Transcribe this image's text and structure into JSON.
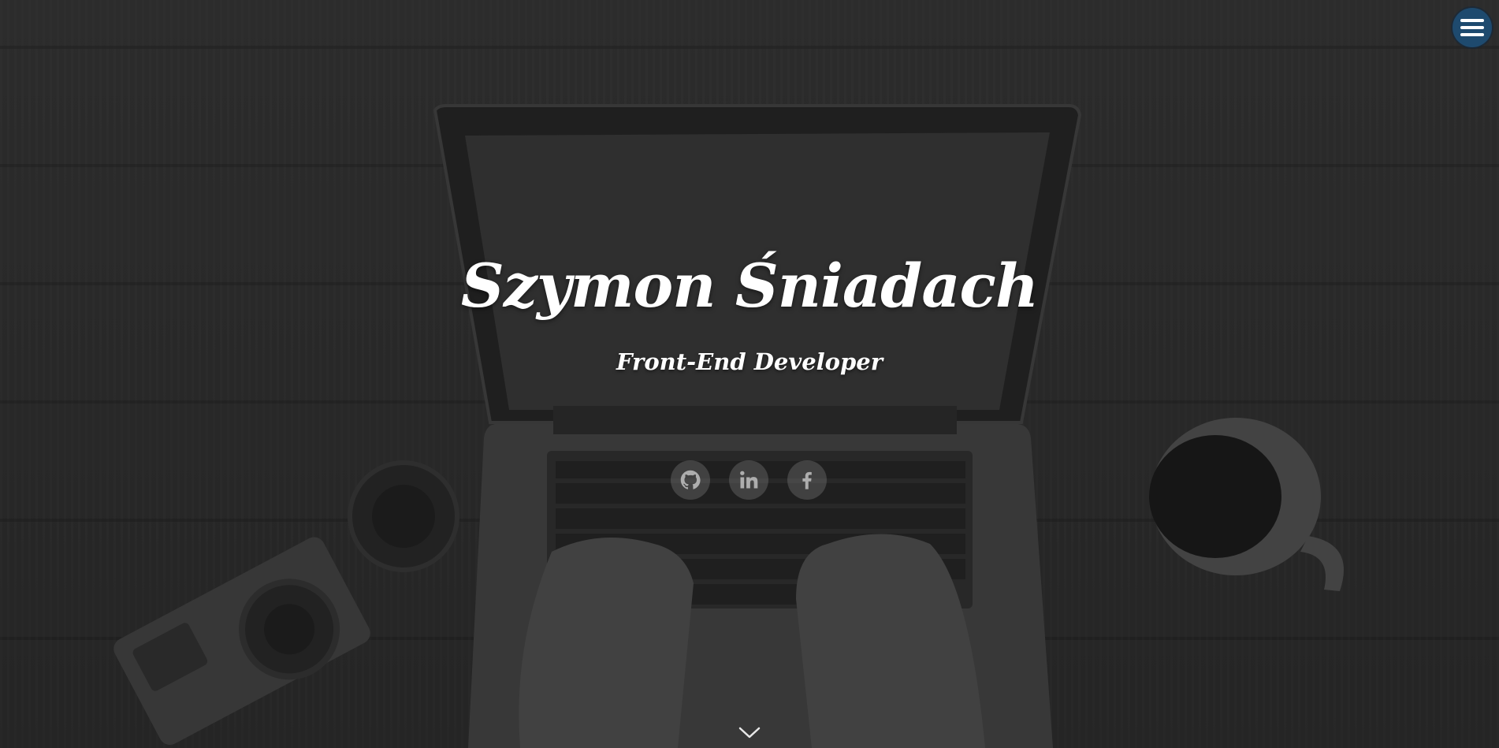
{
  "header": {
    "menu_icon": "hamburger-menu-icon",
    "menu_color": "#1e4a6e"
  },
  "hero": {
    "title": "Szymon Śniadach",
    "subtitle": "Front-End Developer",
    "socials": [
      {
        "name": "github",
        "icon": "github-icon"
      },
      {
        "name": "linkedin",
        "icon": "linkedin-icon"
      },
      {
        "name": "facebook",
        "icon": "facebook-icon"
      }
    ],
    "scroll_icon": "chevron-down-icon"
  }
}
